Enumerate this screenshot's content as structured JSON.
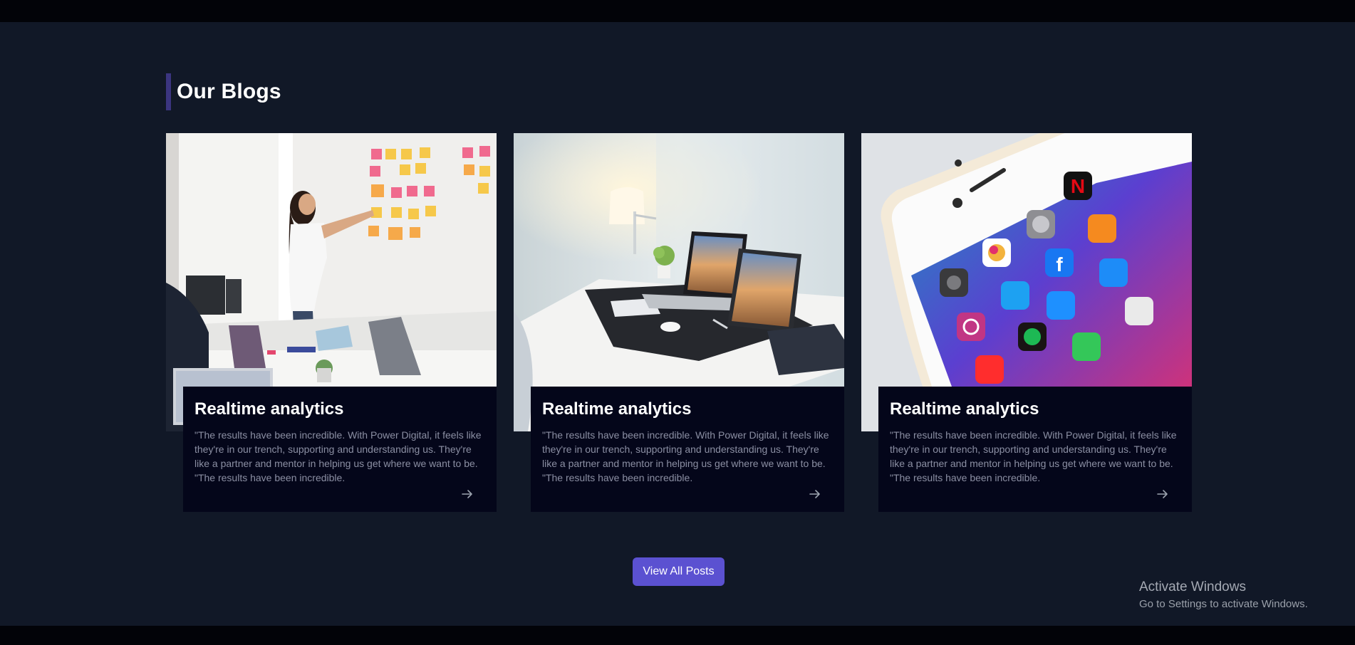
{
  "section": {
    "title": "Our Blogs"
  },
  "cards": [
    {
      "title": "Realtime analytics",
      "text": "\"The results have been incredible. With Power Digital, it feels like they're in our trench, supporting and understanding us. They're like a partner and mentor in helping us get where we want to be. \"The results have been incredible.",
      "image": "woman-presenting-sticky-notes-photo",
      "icon": "arrow-right-icon"
    },
    {
      "title": "Realtime analytics",
      "text": "\"The results have been incredible. With Power Digital, it feels like they're in our trench, supporting and understanding us. They're like a partner and mentor in helping us get where we want to be. \"The results have been incredible.",
      "image": "desk-laptop-tablet-photo",
      "icon": "arrow-right-icon"
    },
    {
      "title": "Realtime analytics",
      "text": "\"The results have been incredible. With Power Digital, it feels like they're in our trench, supporting and understanding us. They're like a partner and mentor in helping us get where we want to be. \"The results have been incredible.",
      "image": "smartphone-home-screen-photo",
      "icon": "arrow-right-icon"
    }
  ],
  "actions": {
    "view_all": "View All Posts"
  },
  "watermark": {
    "line1": "Activate Windows",
    "line2": "Go to Settings to activate Windows."
  },
  "colors": {
    "background": "#111827",
    "card_body": "#04061a",
    "accent": "#5b51d1",
    "title_accent": "#3b3580"
  }
}
